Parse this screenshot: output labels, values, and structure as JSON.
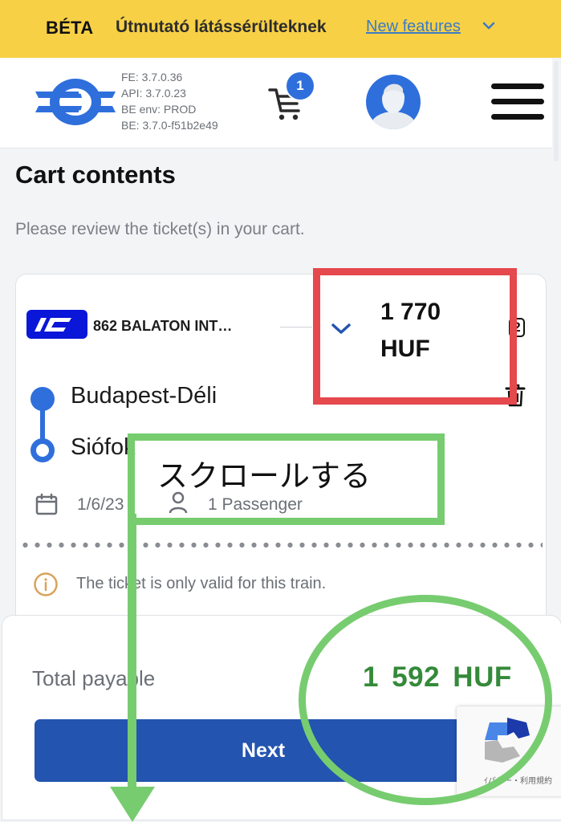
{
  "beta_bar": {
    "beta_label": "BÉTA",
    "guide_label": "Útmutató látássérülteknek",
    "new_features_link": "New features",
    "chevron_icon": "chevron-down-icon"
  },
  "header": {
    "logo_icon": "mav-logo",
    "versions": {
      "fe": "FE: 3.7.0.36",
      "api": "API: 3.7.0.23",
      "be_env": "BE env: PROD",
      "be": "BE: 3.7.0-f51b2e49"
    },
    "cart_count": "1",
    "avatar_icon": "user-avatar-icon",
    "menu_icon": "hamburger-menu-icon"
  },
  "page": {
    "title": "Cart contents",
    "subtitle": "Please review the ticket(s) in your cart."
  },
  "ticket": {
    "train_type_badge": "IC",
    "train_name": "862 BALATON INT…",
    "price_amount": "1 770",
    "price_currency": "HUF",
    "quantity": "2",
    "from_station": "Budapest-Déli",
    "to_station": "Siófok",
    "date": "1/6/23",
    "passengers": "1 Passenger",
    "info_note": "The ticket is only valid for this train."
  },
  "summary": {
    "total_label": "Total payable",
    "total_value": "1 592  HUF",
    "next_button": "Next"
  },
  "recaptcha": {
    "footer_text": "ｲバシー・利用規約"
  },
  "annotations": {
    "scroll_label": "スクロールする",
    "colors": {
      "red": "#e5484d",
      "green": "#77cc6f"
    }
  },
  "colors": {
    "beta_bar": "#f7d046",
    "brand_blue": "#2f6fdc",
    "button_blue": "#2354b0",
    "ic_blue": "#0a16d8",
    "total_green": "#348a3a",
    "info_orange": "#d9a25a"
  }
}
